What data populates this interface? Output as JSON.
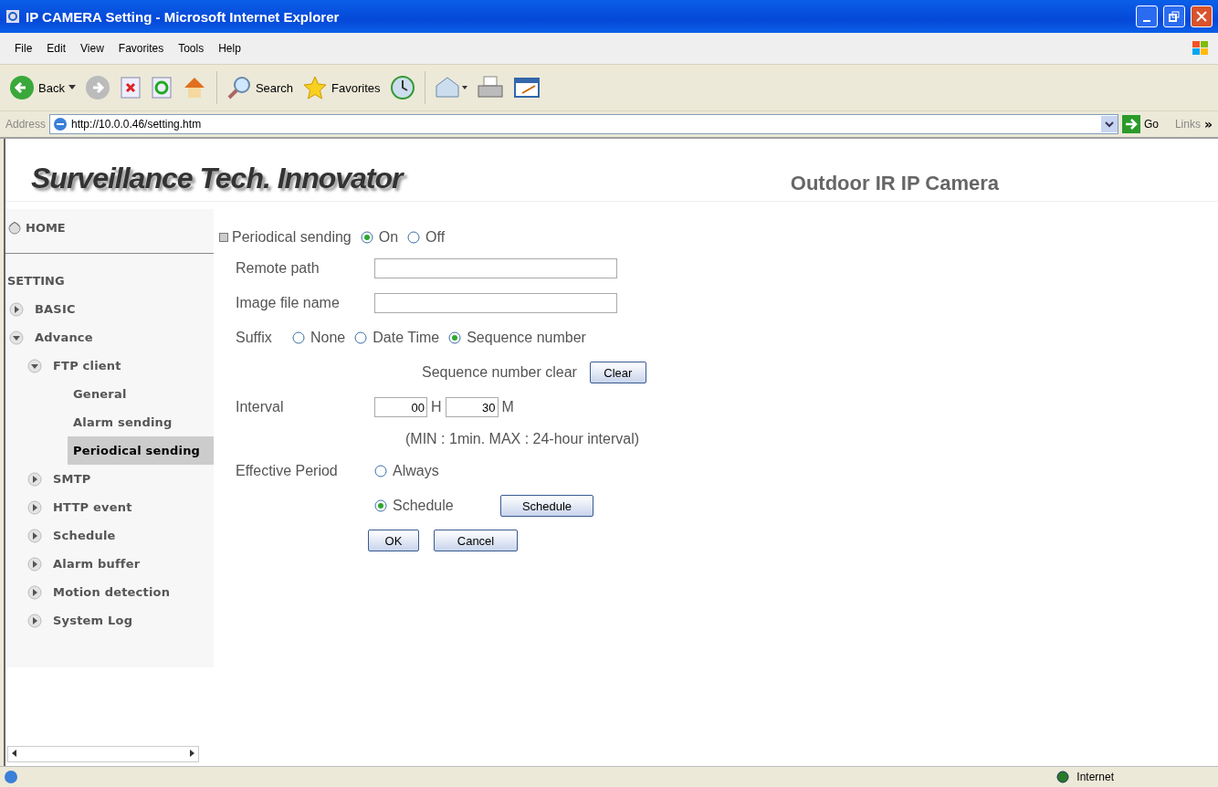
{
  "window": {
    "title": "IP CAMERA Setting - Microsoft Internet Explorer"
  },
  "menu": [
    "File",
    "Edit",
    "View",
    "Favorites",
    "Tools",
    "Help"
  ],
  "toolbar": {
    "back": "Back",
    "search": "Search",
    "favorites": "Favorites"
  },
  "address": {
    "label": "Address",
    "url": "http://10.0.0.46/setting.htm",
    "go": "Go",
    "links": "Links",
    "more": "»"
  },
  "header": {
    "logo": "Surveillance Tech. Innovator",
    "product": "Outdoor IR IP Camera"
  },
  "sidebar": {
    "home": "HOME",
    "section": "SETTING",
    "items": [
      {
        "label": "BASIC",
        "expanded": false,
        "selected": false
      },
      {
        "label": "Advance",
        "expanded": true,
        "selected": false,
        "children": [
          {
            "label": "FTP client",
            "expanded": true,
            "selected": false,
            "children": [
              {
                "label": "General",
                "selected": false
              },
              {
                "label": "Alarm sending",
                "selected": false
              },
              {
                "label": "Periodical sending",
                "selected": true
              }
            ]
          },
          {
            "label": "SMTP",
            "expanded": false,
            "selected": false
          },
          {
            "label": "HTTP event",
            "expanded": false,
            "selected": false
          },
          {
            "label": "Schedule",
            "expanded": false,
            "selected": false
          },
          {
            "label": "Alarm buffer",
            "expanded": false,
            "selected": false
          },
          {
            "label": "Motion detection",
            "expanded": false,
            "selected": false
          },
          {
            "label": "System Log",
            "expanded": false,
            "selected": false
          }
        ]
      }
    ]
  },
  "form": {
    "title": "Periodical sending",
    "switch": [
      {
        "label": "On",
        "selected": true
      },
      {
        "label": "Off",
        "selected": false
      }
    ],
    "remote_path": {
      "label": "Remote path"
    },
    "image_file_name": {
      "label": "Image file name"
    },
    "suffix": {
      "label": "Suffix",
      "options": [
        {
          "label": "None",
          "selected": false
        },
        {
          "label": "Date Time",
          "selected": false
        },
        {
          "label": "Sequence number",
          "selected": true
        }
      ]
    },
    "sequence_clear": {
      "label": "Sequence number clear",
      "button": "Clear"
    },
    "interval": {
      "label": "Interval",
      "hours": "00",
      "hours_unit": "H",
      "minutes": "30",
      "minutes_unit": "M",
      "note": "(MIN : 1min. MAX : 24-hour interval)"
    },
    "effective_period": {
      "label": "Effective Period",
      "options": [
        {
          "label": "Always",
          "selected": false
        },
        {
          "label": "Schedule",
          "selected": true
        }
      ],
      "button": "Schedule"
    },
    "buttons": [
      "OK",
      "Cancel"
    ]
  },
  "status_bar": {
    "zone": "Internet"
  }
}
